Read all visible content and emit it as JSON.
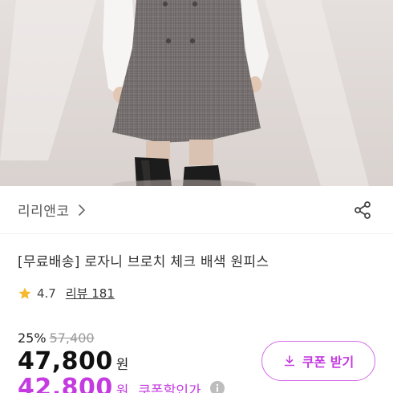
{
  "brand": {
    "name": "리리앤코"
  },
  "product": {
    "title": "[무료배송] 로자니 브로치 체크 배색 원피스",
    "rating": "4.7",
    "review_label": "리뷰 181",
    "discount_rate": "25%",
    "original_price": "57,400",
    "price": "47,800",
    "price_unit": "원",
    "coupon_price": "42,800",
    "coupon_price_unit": "원",
    "coupon_label": "쿠폰할인가"
  },
  "coupon_button": {
    "label": "쿠폰 받기"
  },
  "colors": {
    "accent": "#c43be0",
    "star": "#f5b82e",
    "text": "#222222",
    "muted": "#999999"
  },
  "icons": [
    "chevron-right-icon",
    "share-icon",
    "star-icon",
    "info-icon",
    "download-icon"
  ]
}
